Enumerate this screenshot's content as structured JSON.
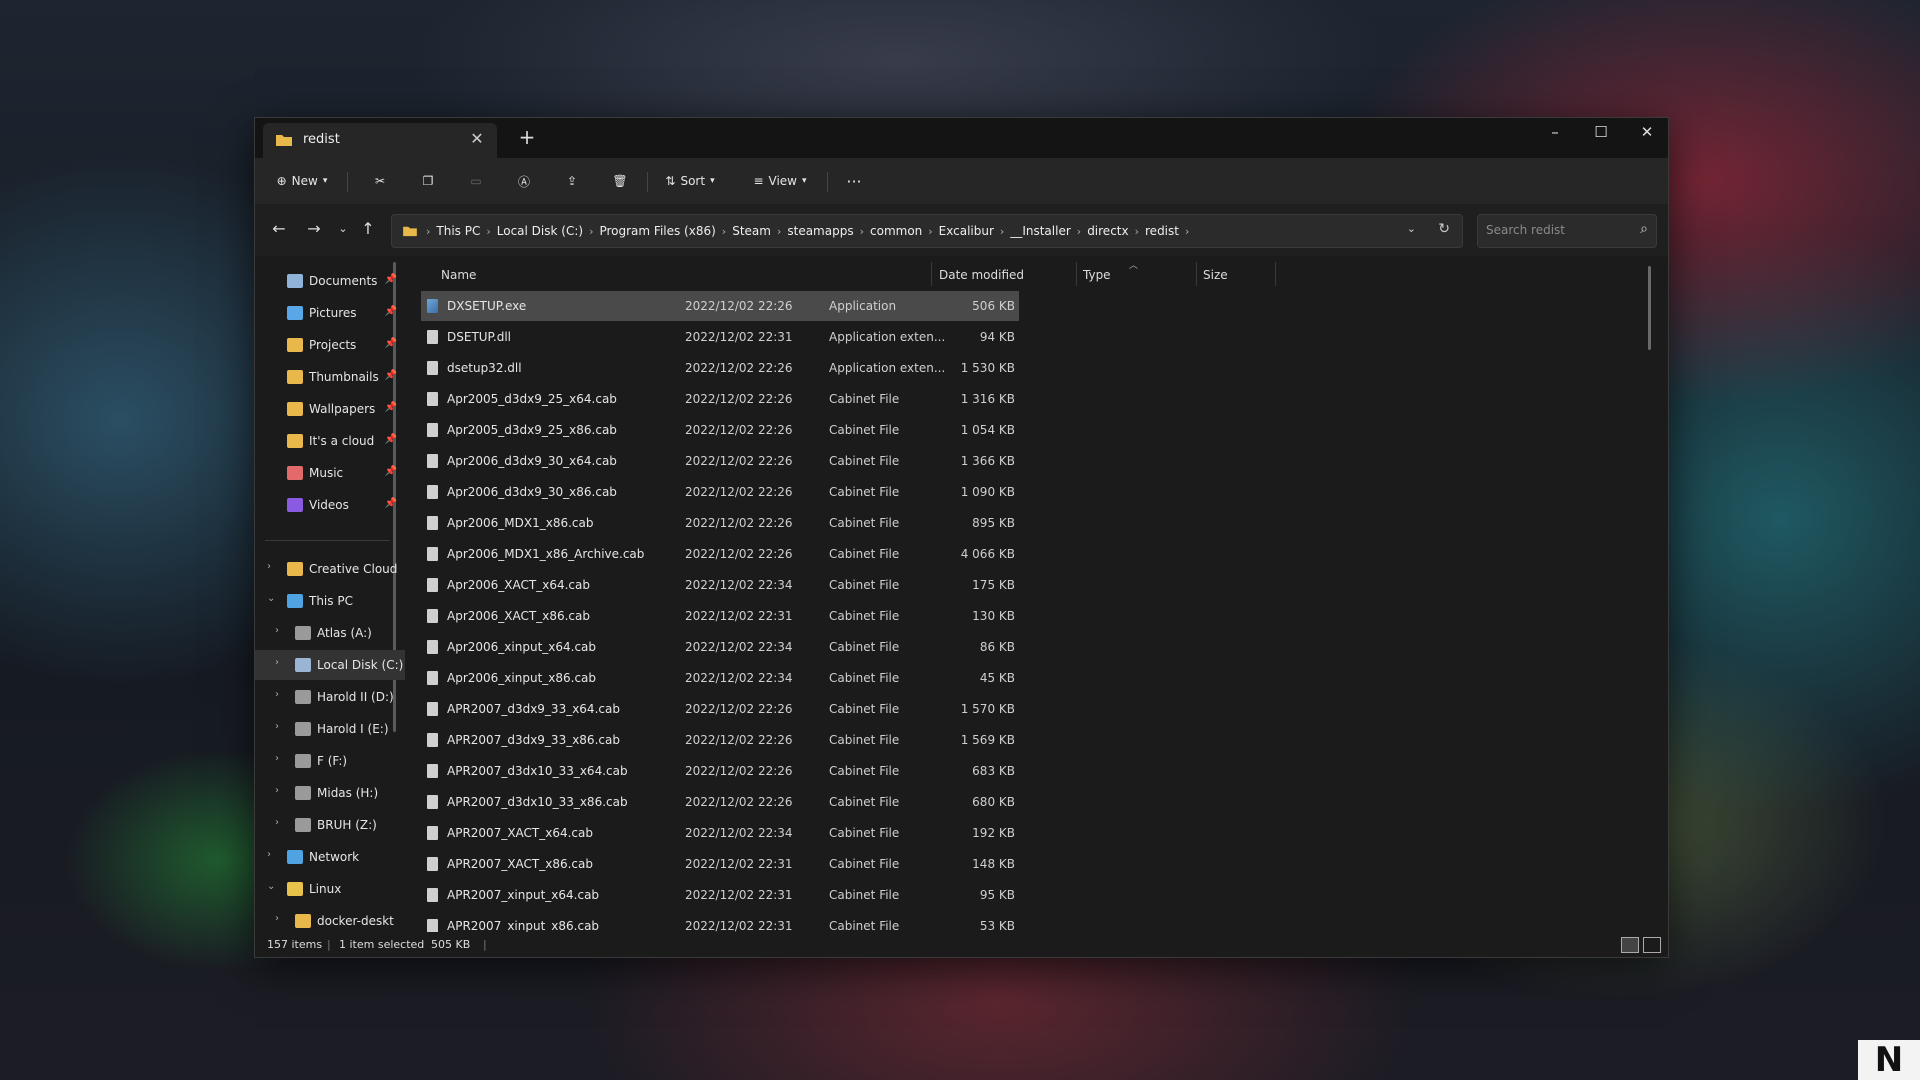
{
  "window": {
    "tab_title": "redist",
    "controls": {
      "minimize": "–",
      "maximize": "☐",
      "close": "✕"
    }
  },
  "toolbar": {
    "new_label": "New",
    "sort_label": "Sort",
    "view_label": "View",
    "more_label": "···"
  },
  "address": {
    "breadcrumbs": [
      "This PC",
      "Local Disk (C:)",
      "Program Files (x86)",
      "Steam",
      "steamapps",
      "common",
      "Excalibur",
      "__Installer",
      "directx",
      "redist"
    ]
  },
  "search": {
    "placeholder": "Search redist"
  },
  "nav": {
    "quick_access": [
      {
        "label": "Documents",
        "color": "#8fb3d9"
      },
      {
        "label": "Pictures",
        "color": "#5aa7e8"
      },
      {
        "label": "Projects",
        "color": "#e8b94a"
      },
      {
        "label": "Thumbnails",
        "color": "#e8b94a"
      },
      {
        "label": "Wallpapers",
        "color": "#e8b94a"
      },
      {
        "label": "It's a cloud",
        "color": "#e8b94a"
      },
      {
        "label": "Music",
        "color": "#e36a6a"
      },
      {
        "label": "Videos",
        "color": "#8a5ae0"
      }
    ],
    "tree": [
      {
        "label": "Creative Cloud",
        "color": "#e8b94a",
        "level": 0,
        "expander": "›"
      },
      {
        "label": "This PC",
        "color": "#4fa3e0",
        "level": 0,
        "expander": "⌄"
      },
      {
        "label": "Atlas (A:)",
        "color": "#9a9a9a",
        "level": 1,
        "expander": "›"
      },
      {
        "label": "Local Disk (C:)",
        "color": "#9ab5d4",
        "level": 1,
        "expander": "›"
      },
      {
        "label": "Harold II (D:)",
        "color": "#9a9a9a",
        "level": 1,
        "expander": "›"
      },
      {
        "label": "Harold I (E:)",
        "color": "#9a9a9a",
        "level": 1,
        "expander": "›"
      },
      {
        "label": "F (F:)",
        "color": "#9a9a9a",
        "level": 1,
        "expander": "›"
      },
      {
        "label": "Midas (H:)",
        "color": "#9a9a9a",
        "level": 1,
        "expander": "›"
      },
      {
        "label": "BRUH (Z:)",
        "color": "#9a9a9a",
        "level": 1,
        "expander": "›"
      },
      {
        "label": "Network",
        "color": "#4fa3e0",
        "level": 0,
        "expander": "›"
      },
      {
        "label": "Linux",
        "color": "#e8c24a",
        "level": 0,
        "expander": "⌄"
      },
      {
        "label": "docker-deskt",
        "color": "#e8b94a",
        "level": 1,
        "expander": "›"
      }
    ]
  },
  "columns": {
    "name": "Name",
    "date": "Date modified",
    "type": "Type",
    "size": "Size"
  },
  "files": [
    {
      "name": "DXSETUP.exe",
      "date": "2022/12/02 22:26",
      "type": "Application",
      "size": "506 KB",
      "icon": "exe"
    },
    {
      "name": "DSETUP.dll",
      "date": "2022/12/02 22:31",
      "type": "Application exten...",
      "size": "94 KB",
      "icon": "dll"
    },
    {
      "name": "dsetup32.dll",
      "date": "2022/12/02 22:26",
      "type": "Application exten...",
      "size": "1 530 KB",
      "icon": "dll"
    },
    {
      "name": "Apr2005_d3dx9_25_x64.cab",
      "date": "2022/12/02 22:26",
      "type": "Cabinet File",
      "size": "1 316 KB",
      "icon": "cab"
    },
    {
      "name": "Apr2005_d3dx9_25_x86.cab",
      "date": "2022/12/02 22:26",
      "type": "Cabinet File",
      "size": "1 054 KB",
      "icon": "cab"
    },
    {
      "name": "Apr2006_d3dx9_30_x64.cab",
      "date": "2022/12/02 22:26",
      "type": "Cabinet File",
      "size": "1 366 KB",
      "icon": "cab"
    },
    {
      "name": "Apr2006_d3dx9_30_x86.cab",
      "date": "2022/12/02 22:26",
      "type": "Cabinet File",
      "size": "1 090 KB",
      "icon": "cab"
    },
    {
      "name": "Apr2006_MDX1_x86.cab",
      "date": "2022/12/02 22:26",
      "type": "Cabinet File",
      "size": "895 KB",
      "icon": "cab"
    },
    {
      "name": "Apr2006_MDX1_x86_Archive.cab",
      "date": "2022/12/02 22:26",
      "type": "Cabinet File",
      "size": "4 066 KB",
      "icon": "cab"
    },
    {
      "name": "Apr2006_XACT_x64.cab",
      "date": "2022/12/02 22:34",
      "type": "Cabinet File",
      "size": "175 KB",
      "icon": "cab"
    },
    {
      "name": "Apr2006_XACT_x86.cab",
      "date": "2022/12/02 22:31",
      "type": "Cabinet File",
      "size": "130 KB",
      "icon": "cab"
    },
    {
      "name": "Apr2006_xinput_x64.cab",
      "date": "2022/12/02 22:34",
      "type": "Cabinet File",
      "size": "86 KB",
      "icon": "cab"
    },
    {
      "name": "Apr2006_xinput_x86.cab",
      "date": "2022/12/02 22:34",
      "type": "Cabinet File",
      "size": "45 KB",
      "icon": "cab"
    },
    {
      "name": "APR2007_d3dx9_33_x64.cab",
      "date": "2022/12/02 22:26",
      "type": "Cabinet File",
      "size": "1 570 KB",
      "icon": "cab"
    },
    {
      "name": "APR2007_d3dx9_33_x86.cab",
      "date": "2022/12/02 22:26",
      "type": "Cabinet File",
      "size": "1 569 KB",
      "icon": "cab"
    },
    {
      "name": "APR2007_d3dx10_33_x64.cab",
      "date": "2022/12/02 22:26",
      "type": "Cabinet File",
      "size": "683 KB",
      "icon": "cab"
    },
    {
      "name": "APR2007_d3dx10_33_x86.cab",
      "date": "2022/12/02 22:26",
      "type": "Cabinet File",
      "size": "680 KB",
      "icon": "cab"
    },
    {
      "name": "APR2007_XACT_x64.cab",
      "date": "2022/12/02 22:34",
      "type": "Cabinet File",
      "size": "192 KB",
      "icon": "cab"
    },
    {
      "name": "APR2007_XACT_x86.cab",
      "date": "2022/12/02 22:31",
      "type": "Cabinet File",
      "size": "148 KB",
      "icon": "cab"
    },
    {
      "name": "APR2007_xinput_x64.cab",
      "date": "2022/12/02 22:31",
      "type": "Cabinet File",
      "size": "95 KB",
      "icon": "cab"
    },
    {
      "name": "APR2007_xinput_x86.cab",
      "date": "2022/12/02 22:31",
      "type": "Cabinet File",
      "size": "53 KB",
      "icon": "cab"
    }
  ],
  "selected_index": 0,
  "status": {
    "items": "157 items",
    "selected": "1 item selected",
    "size": "505 KB"
  },
  "corner_logo": "N"
}
